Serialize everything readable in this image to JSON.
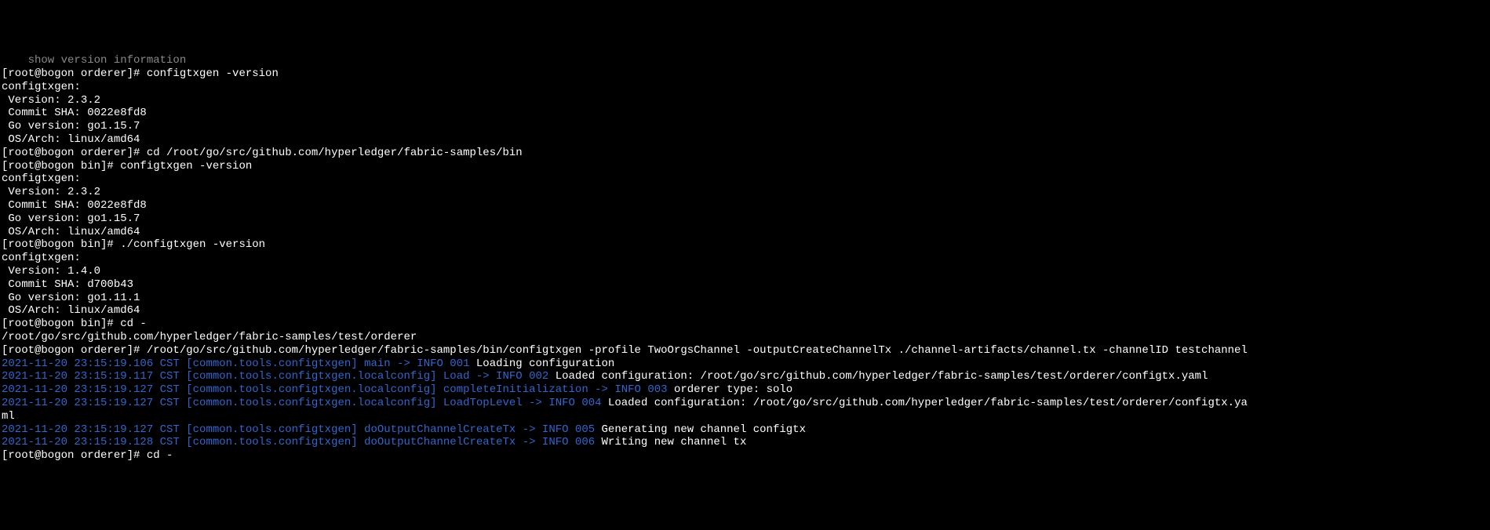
{
  "lines": [
    {
      "parts": [
        {
          "cls": "dim",
          "text": "    show version information"
        }
      ]
    },
    {
      "parts": [
        {
          "cls": "white",
          "text": "[root@bogon orderer]# configtxgen -version"
        }
      ]
    },
    {
      "parts": [
        {
          "cls": "white",
          "text": "configtxgen:"
        }
      ]
    },
    {
      "parts": [
        {
          "cls": "white",
          "text": " Version: 2.3.2"
        }
      ]
    },
    {
      "parts": [
        {
          "cls": "white",
          "text": " Commit SHA: 0022e8fd8"
        }
      ]
    },
    {
      "parts": [
        {
          "cls": "white",
          "text": " Go version: go1.15.7"
        }
      ]
    },
    {
      "parts": [
        {
          "cls": "white",
          "text": " OS/Arch: linux/amd64"
        }
      ]
    },
    {
      "parts": [
        {
          "cls": "white",
          "text": "[root@bogon orderer]# cd /root/go/src/github.com/hyperledger/fabric-samples/bin"
        }
      ]
    },
    {
      "parts": [
        {
          "cls": "white",
          "text": "[root@bogon bin]# configtxgen -version"
        }
      ]
    },
    {
      "parts": [
        {
          "cls": "white",
          "text": "configtxgen:"
        }
      ]
    },
    {
      "parts": [
        {
          "cls": "white",
          "text": " Version: 2.3.2"
        }
      ]
    },
    {
      "parts": [
        {
          "cls": "white",
          "text": " Commit SHA: 0022e8fd8"
        }
      ]
    },
    {
      "parts": [
        {
          "cls": "white",
          "text": " Go version: go1.15.7"
        }
      ]
    },
    {
      "parts": [
        {
          "cls": "white",
          "text": " OS/Arch: linux/amd64"
        }
      ]
    },
    {
      "parts": [
        {
          "cls": "white",
          "text": "[root@bogon bin]# ./configtxgen -version"
        }
      ]
    },
    {
      "parts": [
        {
          "cls": "white",
          "text": "configtxgen:"
        }
      ]
    },
    {
      "parts": [
        {
          "cls": "white",
          "text": " Version: 1.4.0"
        }
      ]
    },
    {
      "parts": [
        {
          "cls": "white",
          "text": " Commit SHA: d700b43"
        }
      ]
    },
    {
      "parts": [
        {
          "cls": "white",
          "text": " Go version: go1.11.1"
        }
      ]
    },
    {
      "parts": [
        {
          "cls": "white",
          "text": " OS/Arch: linux/amd64"
        }
      ]
    },
    {
      "parts": [
        {
          "cls": "white",
          "text": "[root@bogon bin]# cd -"
        }
      ]
    },
    {
      "parts": [
        {
          "cls": "white",
          "text": "/root/go/src/github.com/hyperledger/fabric-samples/test/orderer"
        }
      ]
    },
    {
      "parts": [
        {
          "cls": "white",
          "text": "[root@bogon orderer]# /root/go/src/github.com/hyperledger/fabric-samples/bin/configtxgen -profile TwoOrgsChannel -outputCreateChannelTx ./channel-artifacts/channel.tx -channelID testchannel"
        }
      ]
    },
    {
      "parts": [
        {
          "cls": "blue",
          "text": "2021-11-20 23:15:19.106 CST [common.tools.configtxgen] main -> INFO 001"
        },
        {
          "cls": "white",
          "text": " Loading configuration"
        }
      ]
    },
    {
      "parts": [
        {
          "cls": "blue",
          "text": "2021-11-20 23:15:19.117 CST [common.tools.configtxgen.localconfig] Load -> INFO 002"
        },
        {
          "cls": "white",
          "text": " Loaded configuration: /root/go/src/github.com/hyperledger/fabric-samples/test/orderer/configtx.yaml"
        }
      ]
    },
    {
      "parts": [
        {
          "cls": "blue",
          "text": "2021-11-20 23:15:19.127 CST [common.tools.configtxgen.localconfig] completeInitialization -> INFO 003"
        },
        {
          "cls": "white",
          "text": " orderer type: solo"
        }
      ]
    },
    {
      "parts": [
        {
          "cls": "blue",
          "text": "2021-11-20 23:15:19.127 CST [common.tools.configtxgen.localconfig] LoadTopLevel -> INFO 004"
        },
        {
          "cls": "white",
          "text": " Loaded configuration: /root/go/src/github.com/hyperledger/fabric-samples/test/orderer/configtx.ya"
        }
      ]
    },
    {
      "parts": [
        {
          "cls": "white",
          "text": "ml"
        }
      ]
    },
    {
      "parts": [
        {
          "cls": "blue",
          "text": "2021-11-20 23:15:19.127 CST [common.tools.configtxgen] doOutputChannelCreateTx -> INFO 005"
        },
        {
          "cls": "white",
          "text": " Generating new channel configtx"
        }
      ]
    },
    {
      "parts": [
        {
          "cls": "blue",
          "text": "2021-11-20 23:15:19.128 CST [common.tools.configtxgen] doOutputChannelCreateTx -> INFO 006"
        },
        {
          "cls": "white",
          "text": " Writing new channel tx"
        }
      ]
    },
    {
      "parts": [
        {
          "cls": "white",
          "text": "[root@bogon orderer]# cd -"
        }
      ]
    }
  ]
}
